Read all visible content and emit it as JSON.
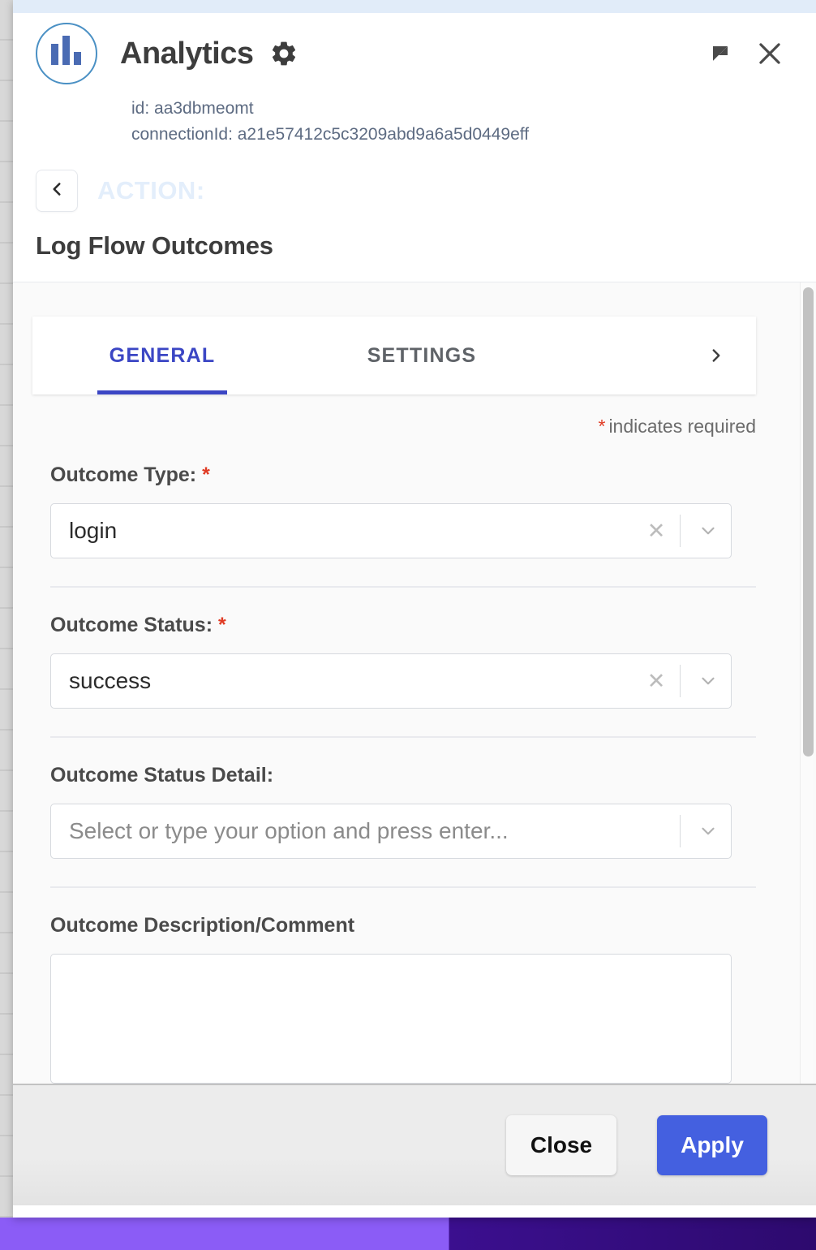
{
  "app": {
    "title": "Analytics",
    "logo_icon": "bar-chart-icon",
    "settings_icon": "gear-icon",
    "restore_icon": "restore-window-icon",
    "close_icon": "close-icon",
    "id_line": "id: aa3dbmeomt",
    "connection_line": "connectionId: a21e57412c5c3209abd9a6a5d0449eff"
  },
  "breadcrumb": {
    "back_icon": "chevron-left-icon",
    "action_label": "ACTION:",
    "flow_title": "Log Flow Outcomes"
  },
  "tabs": {
    "items": [
      {
        "label": "GENERAL",
        "active": true
      },
      {
        "label": "SETTINGS",
        "active": false
      }
    ],
    "next_icon": "chevron-right-icon"
  },
  "form": {
    "required_star": "*",
    "required_note": "indicates required",
    "fields": [
      {
        "label": "Outcome Type:",
        "required": true,
        "value": "login",
        "placeholder": "",
        "clear_icon": "clear-x-icon",
        "caret_icon": "chevron-down-icon"
      },
      {
        "label": "Outcome Status:",
        "required": true,
        "value": "success",
        "placeholder": "",
        "clear_icon": "clear-x-icon",
        "caret_icon": "chevron-down-icon"
      },
      {
        "label": "Outcome Status Detail:",
        "required": false,
        "value": "",
        "placeholder": "Select or type your option and press enter...",
        "caret_icon": "chevron-down-icon"
      },
      {
        "label": "Outcome Description/Comment",
        "required": false,
        "value": ""
      }
    ]
  },
  "footer": {
    "close_label": "Close",
    "apply_label": "Apply"
  },
  "colors": {
    "accent_blue": "#3b46c4",
    "apply_button": "#4460e0",
    "required_red": "#e03b24",
    "logo_blue": "#4a6bb3",
    "action_label_faded": "#e3eefb"
  }
}
